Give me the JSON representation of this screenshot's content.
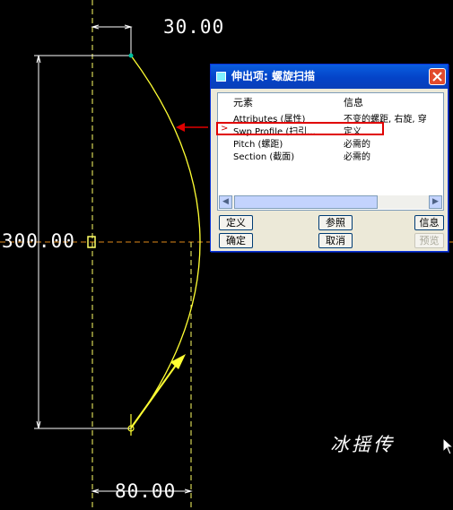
{
  "dimensions": {
    "top": "30.00",
    "left": "300.00",
    "bottom": "80.00"
  },
  "watermark": "冰摇传",
  "dialog": {
    "title": "伸出项: 螺旋扫描",
    "columns": {
      "element": "元素",
      "info": "信息"
    },
    "rows": [
      {
        "element": "Attributes (属性)",
        "info": "不变的螺距, 右旋, 穿"
      },
      {
        "element": "Swp Profile (扫引...",
        "info": "定义"
      },
      {
        "element": "Pitch (螺距)",
        "info": "必需的"
      },
      {
        "element": "Section (截面)",
        "info": "必需的"
      }
    ],
    "buttons": {
      "define": "定义",
      "refs": "参照",
      "info": "信息",
      "ok": "确定",
      "cancel": "取消",
      "preview": "预览"
    }
  }
}
